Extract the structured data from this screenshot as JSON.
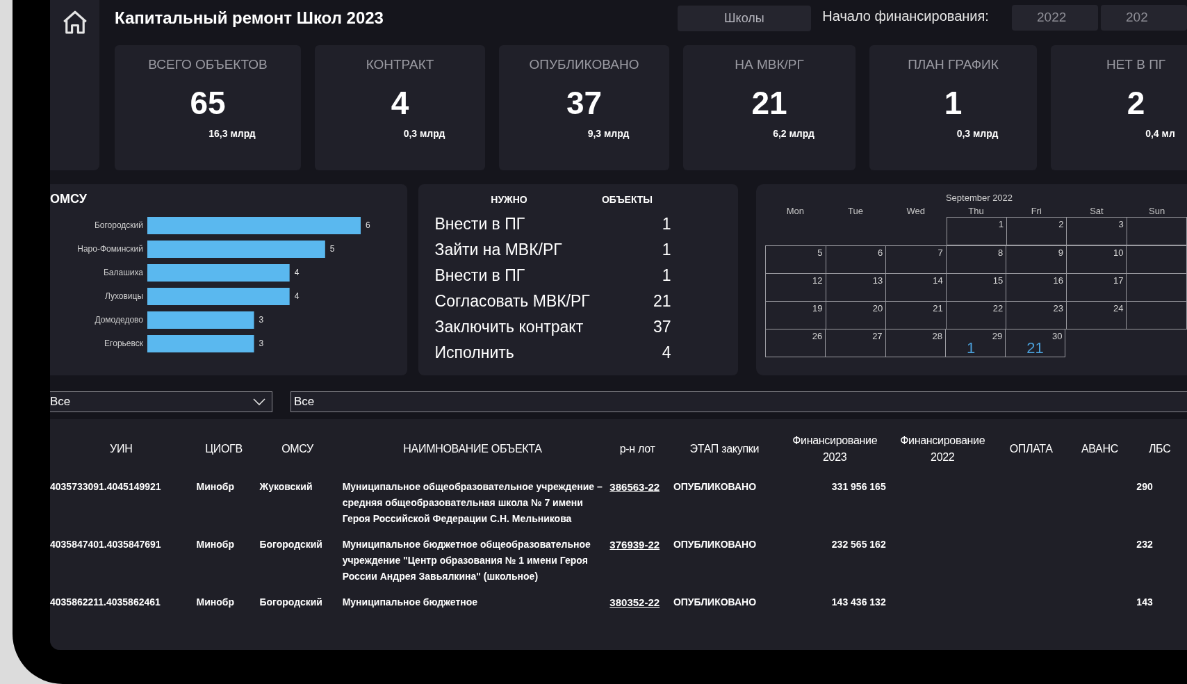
{
  "header": {
    "title": "Капитальный ремонт Школ 2023",
    "category_button": "Школы",
    "financing_label": "Начало финансирования:",
    "years": [
      {
        "label": "2022",
        "selected": false
      },
      {
        "label": "202",
        "selected": false
      }
    ]
  },
  "cards": [
    {
      "label": "ВСЕГО ОБЪЕКТОВ",
      "value": "65",
      "amount": "16,3 млрд"
    },
    {
      "label": "КОНТРАКТ",
      "value": "4",
      "amount": "0,3 млрд"
    },
    {
      "label": "ОПУБЛИКОВАНО",
      "value": "37",
      "amount": "9,3 млрд"
    },
    {
      "label": "НА МВК/РГ",
      "value": "21",
      "amount": "6,2 млрд"
    },
    {
      "label": "ПЛАН ГРАФИК",
      "value": "1",
      "amount": "0,3 млрд"
    },
    {
      "label": "НЕТ В ПГ",
      "value": "2",
      "amount": "0,4 мл"
    }
  ],
  "omsu_panel": {
    "title": "ОМСУ",
    "chart_data": {
      "type": "bar",
      "orientation": "horizontal",
      "data_labels": true,
      "categories": [
        "Богородский",
        "Наро-Фоминский",
        "Балашиха",
        "Луховицы",
        "Домодедово",
        "Егорьевск"
      ],
      "series": [
        {
          "color": "#5ab8ef",
          "values": [
            6,
            5,
            4,
            4,
            3,
            3
          ]
        }
      ]
    }
  },
  "needs_panel": {
    "columns": [
      "НУЖНО",
      "ОБЪЕКТЫ"
    ],
    "rows": [
      {
        "action": "Внести в ПГ",
        "count": "1"
      },
      {
        "action": "Зайти на МВК/РГ",
        "count": "1"
      },
      {
        "action": "Внести в ПГ",
        "count": "1"
      },
      {
        "action": "Согласовать МВК/РГ",
        "count": "21"
      },
      {
        "action": "Заключить контракт",
        "count": "37"
      },
      {
        "action": "Исполнить",
        "count": "4"
      }
    ]
  },
  "calendar": {
    "month": "September 2022",
    "weekdays": [
      "Mon",
      "Tue",
      "Wed",
      "Thu",
      "Fri",
      "Sat",
      "Sun"
    ],
    "weeks": [
      [
        {
          "kind": "none"
        },
        {
          "kind": "none"
        },
        {
          "kind": "none"
        },
        {
          "kind": "day",
          "day": "1"
        },
        {
          "kind": "day",
          "day": "2"
        },
        {
          "kind": "day",
          "day": "3"
        },
        {
          "kind": "cut"
        }
      ],
      [
        {
          "kind": "day",
          "day": "5"
        },
        {
          "kind": "day",
          "day": "6"
        },
        {
          "kind": "day",
          "day": "7"
        },
        {
          "kind": "day",
          "day": "8"
        },
        {
          "kind": "day",
          "day": "9"
        },
        {
          "kind": "day",
          "day": "10"
        },
        {
          "kind": "cut"
        }
      ],
      [
        {
          "kind": "day",
          "day": "12"
        },
        {
          "kind": "day",
          "day": "13"
        },
        {
          "kind": "day",
          "day": "14"
        },
        {
          "kind": "day",
          "day": "15"
        },
        {
          "kind": "day",
          "day": "16"
        },
        {
          "kind": "day",
          "day": "17"
        },
        {
          "kind": "cut"
        }
      ],
      [
        {
          "kind": "day",
          "day": "19"
        },
        {
          "kind": "day",
          "day": "20"
        },
        {
          "kind": "day",
          "day": "21"
        },
        {
          "kind": "day",
          "day": "22"
        },
        {
          "kind": "day",
          "day": "23"
        },
        {
          "kind": "day",
          "day": "24"
        },
        {
          "kind": "cut"
        }
      ],
      [
        {
          "kind": "day",
          "day": "26"
        },
        {
          "kind": "day",
          "day": "27"
        },
        {
          "kind": "day",
          "day": "28"
        },
        {
          "kind": "day",
          "day": "29",
          "count": "1"
        },
        {
          "kind": "day",
          "day": "30",
          "count": "21"
        },
        {
          "kind": "none"
        },
        {
          "kind": "none"
        }
      ]
    ]
  },
  "filters": {
    "dropdown_value": "Все",
    "search_value": "Все"
  },
  "table": {
    "columns": [
      "УИН",
      "ЦИОГВ",
      "ОМСУ",
      "НАИМНОВАНИЕ ОБЪЕКТА",
      "р-н лот",
      "ЭТАП закупки",
      "Финансирование 2023",
      "Финансирование 2022",
      "ОПЛАТА",
      "АВАНС",
      "ЛБС"
    ],
    "rows": [
      {
        "uin": "4035733091.4045149921",
        "ciogv": "Минобр",
        "omsu": "Жуковский",
        "name": "Муниципальное общеобразовательное учреждение – средняя общеобразовательная школа № 7 имени Героя Российской Федерации С.Н. Мельникова",
        "lot": "386563-22",
        "stage": "ОПУБЛИКОВАНО",
        "fin_2023": "331 956 165",
        "lbs": "290"
      },
      {
        "uin": "4035847401.4035847691",
        "ciogv": "Минобр",
        "omsu": "Богородский",
        "name": "Муниципальное бюджетное общеобразовательное учреждение \"Центр образования № 1 имени Героя России Андрея Завьялкина\" (школьное)",
        "lot": "376939-22",
        "stage": "ОПУБЛИКОВАНО",
        "fin_2023": "232 565 162",
        "lbs": "232"
      },
      {
        "uin": "4035862211.4035862461",
        "ciogv": "Минобр",
        "omsu": "Богородский",
        "name": "Муниципальное бюджетное",
        "lot": "380352-22",
        "stage": "ОПУБЛИКОВАНО",
        "fin_2023": "143 436 132",
        "lbs": "143"
      }
    ]
  }
}
